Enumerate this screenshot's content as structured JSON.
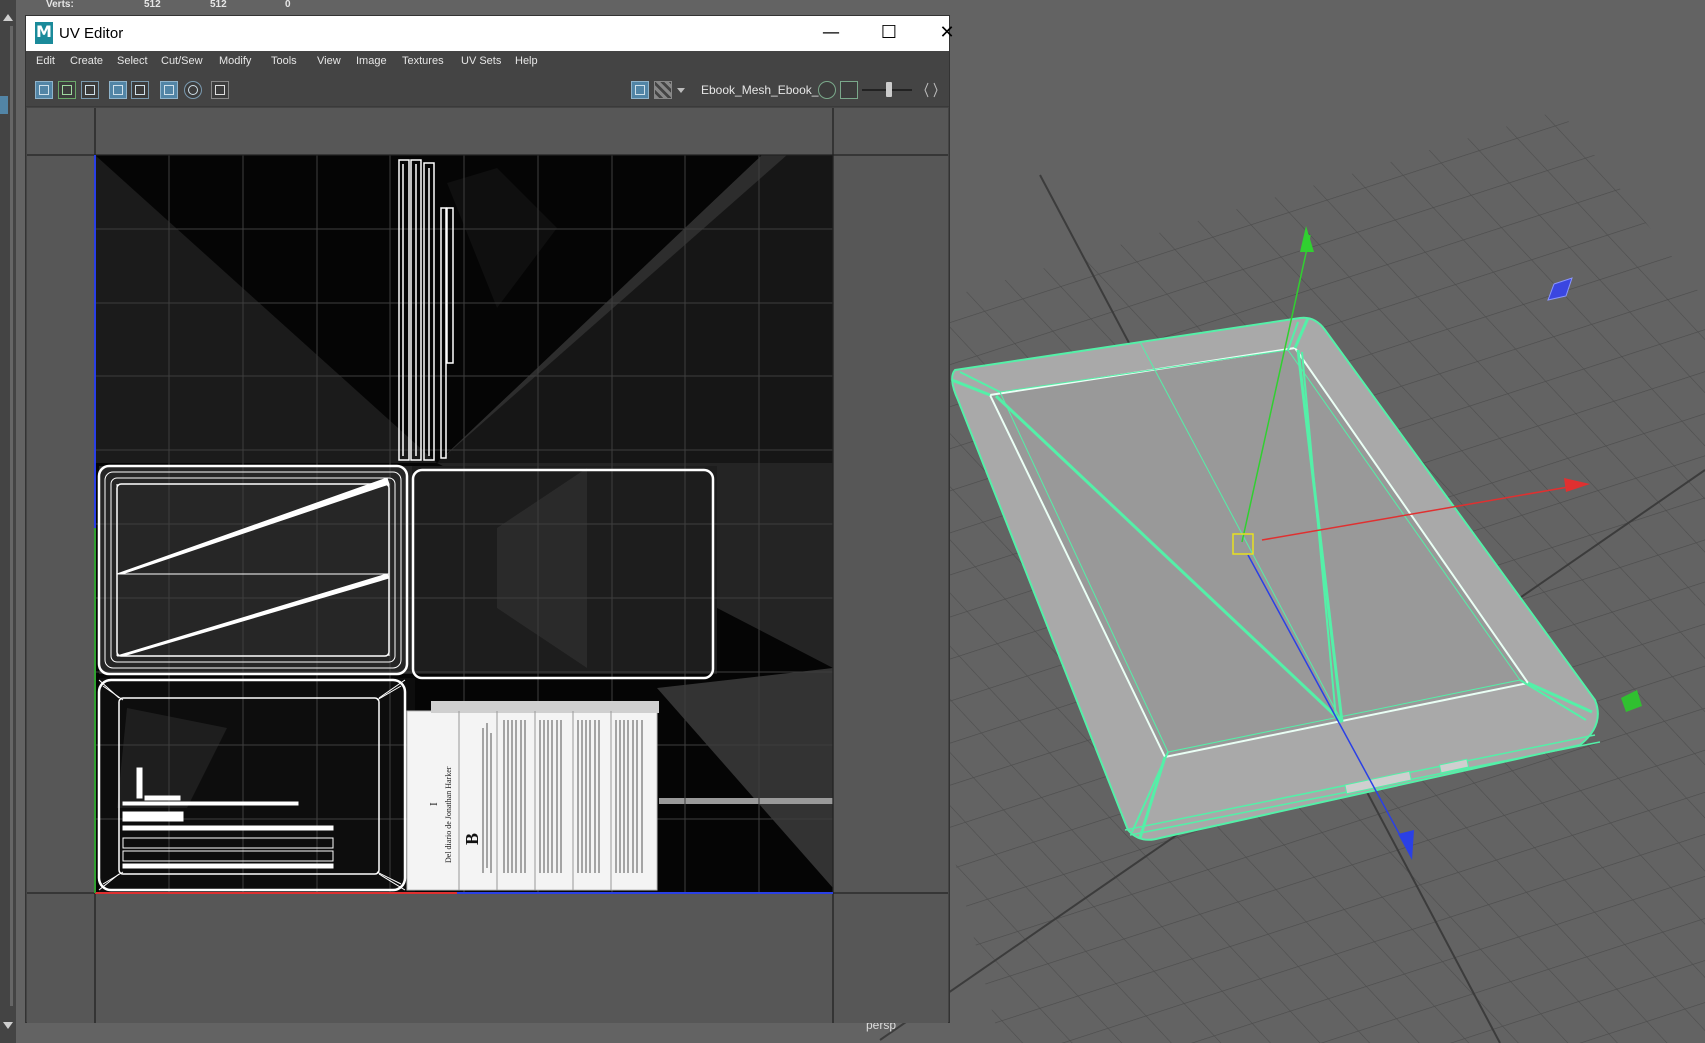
{
  "stats": {
    "label": "Verts:",
    "values": [
      "512",
      "512",
      "0"
    ]
  },
  "viewport": {
    "camera_label": "persp"
  },
  "uv_editor": {
    "title": "UV Editor",
    "menus": [
      "Edit",
      "Create",
      "Select",
      "Cut/Sew",
      "Modify",
      "Tools",
      "View",
      "Image",
      "Textures",
      "UV Sets",
      "Help"
    ],
    "mesh_selector": "Ebook_Mesh_Ebook_",
    "window_buttons": {
      "minimize": "—",
      "maximize": "☐",
      "close": "✕"
    }
  },
  "texture_text": {
    "book_title": "Del diario de Jonathan Harker",
    "chapter": "I",
    "drop_cap": "B"
  },
  "colors": {
    "selection": "#54f0a8",
    "axis_x": "#e03030",
    "axis_y": "#30d030",
    "axis_z": "#2a40e6",
    "accent": "#5285a6"
  }
}
